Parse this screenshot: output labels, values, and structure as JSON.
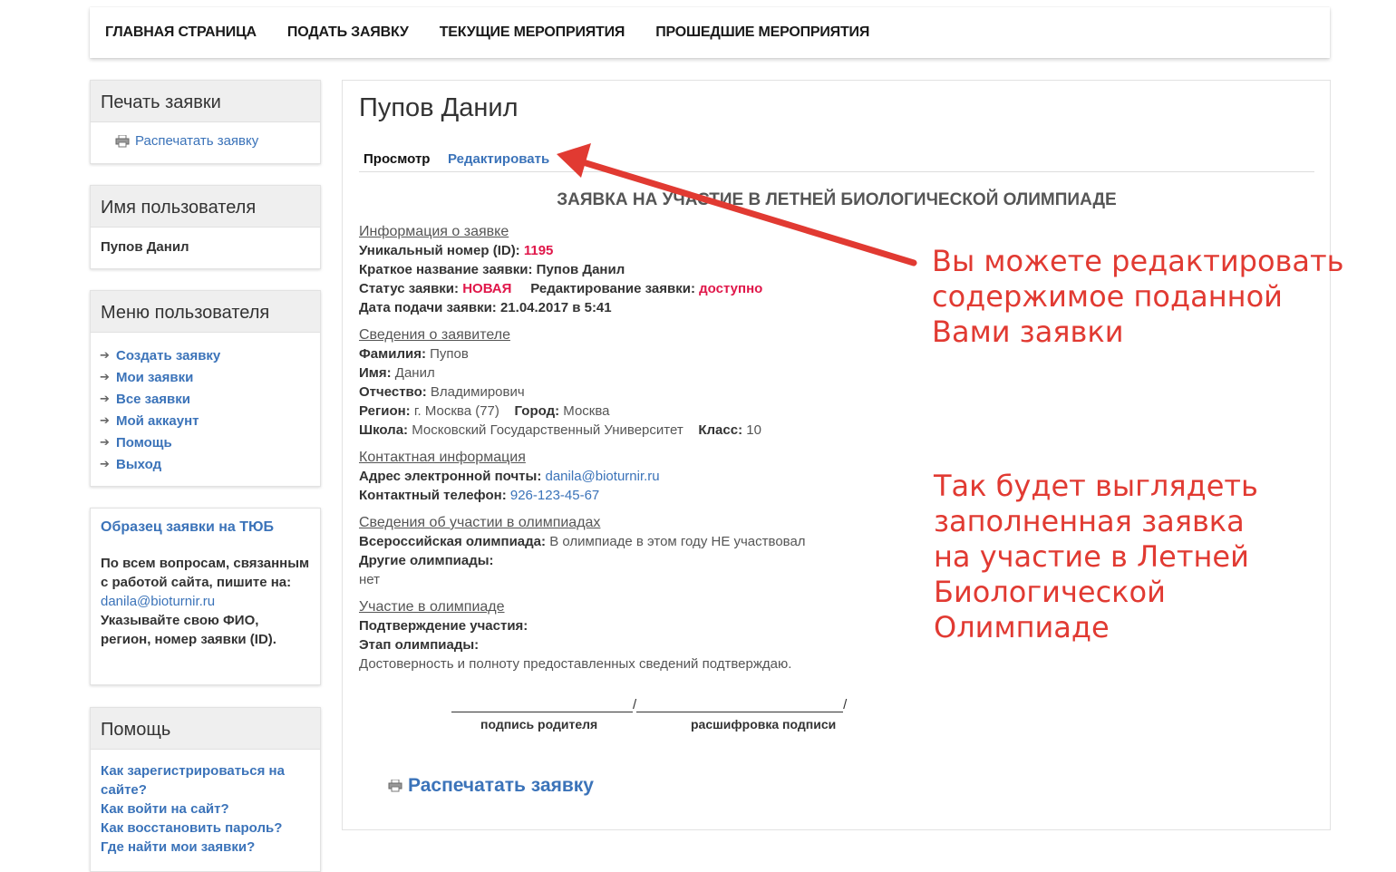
{
  "nav": {
    "items": [
      "ГЛАВНАЯ СТРАНИЦА",
      "ПОДАТЬ ЗАЯВКУ",
      "ТЕКУЩИЕ МЕРОПРИЯТИЯ",
      "ПРОШЕДШИЕ МЕРОПРИЯТИЯ"
    ]
  },
  "sidebar": {
    "print_block": {
      "title": "Печать заявки",
      "link": "Распечатать заявку"
    },
    "user_block": {
      "title": "Имя пользователя",
      "name": "Пупов Данил"
    },
    "menu_block": {
      "title": "Меню пользователя",
      "items": [
        "Создать заявку",
        "Мои заявки",
        "Все заявки",
        "Мой аккаунт",
        "Помощь",
        "Выход"
      ]
    },
    "info_block": {
      "sample_link": "Образец заявки на ТЮБ",
      "text1": "По всем вопросам, связанным с работой сайта, пишите на:",
      "email": "danila@bioturnir.ru",
      "text2": "Указывайте свою ФИО, регион, номер заявки (ID)."
    },
    "help_block": {
      "title": "Помощь",
      "items": [
        "Как зарегистрироваться на сайте?",
        "Как войти на сайт?",
        "Как восстановить пароль?",
        "Где найти мои заявки?"
      ]
    }
  },
  "main": {
    "title": "Пупов Данил",
    "tabs": {
      "view": "Просмотр",
      "edit": "Редактировать"
    },
    "form_title": "ЗАЯВКА НА УЧАСТИЕ В ЛЕТНЕЙ БИОЛОГИЧЕСКОЙ ОЛИМПИАДЕ",
    "sec_info": {
      "heading": "Информация о заявке",
      "id_label": "Уникальный номер (ID):",
      "id_value": "1195",
      "short_label": "Краткое название заявки:",
      "short_value": "Пупов Данил",
      "status_label": "Статус заявки:",
      "status_value": "НОВАЯ",
      "edit_label": "Редактирование заявки:",
      "edit_value": "доступно",
      "date_label": "Дата подачи заявки:",
      "date_value": "21.04.2017 в 5:41"
    },
    "sec_applicant": {
      "heading": "Сведения о заявителе",
      "surname_label": "Фамилия:",
      "surname_value": "Пупов",
      "name_label": "Имя:",
      "name_value": "Данил",
      "patronymic_label": "Отчество:",
      "patronymic_value": "Владимирович",
      "region_label": "Регион:",
      "region_value": "г. Москва (77)",
      "city_label": "Город:",
      "city_value": "Москва",
      "school_label": "Школа:",
      "school_value": "Московский Государственный Университет",
      "class_label": "Класс:",
      "class_value": "10"
    },
    "sec_contact": {
      "heading": "Контактная информация",
      "email_label": "Адрес электронной почты:",
      "email_value": "danila@bioturnir.ru",
      "phone_label": "Контактный телефон:",
      "phone_value": "926-123-45-67"
    },
    "sec_olymp": {
      "heading": "Сведения об участии в олимпиадах",
      "vseros_label": "Всероссийская олимпиада:",
      "vseros_value": "В олимпиаде в этом году НЕ участвовал",
      "other_label": "Другие олимпиады:",
      "other_value": "нет"
    },
    "sec_part": {
      "heading": "Участие в олимпиаде",
      "confirm_label": "Подтверждение участия:",
      "stage_label": "Этап олимпиады:",
      "statement": "Достоверность и полноту предоставленных сведений подтверждаю."
    },
    "signature": {
      "slash": "/",
      "parent": "подпись родителя",
      "decode": "расшифровка подписи"
    },
    "print_link": "Распечатать заявку"
  },
  "annotations": {
    "edit_note": [
      "Вы можете редактировать",
      "содержимое поданной",
      "Вами заявки"
    ],
    "view_note": [
      "Так будет выглядеть",
      "заполненная заявка",
      "на участие в Летней",
      "Биологической",
      "Олимпиаде"
    ],
    "color": "#e13a32"
  },
  "colors": {
    "link": "#3b73b9",
    "status_red": "#e0174a",
    "panel_header": "#efefef"
  }
}
